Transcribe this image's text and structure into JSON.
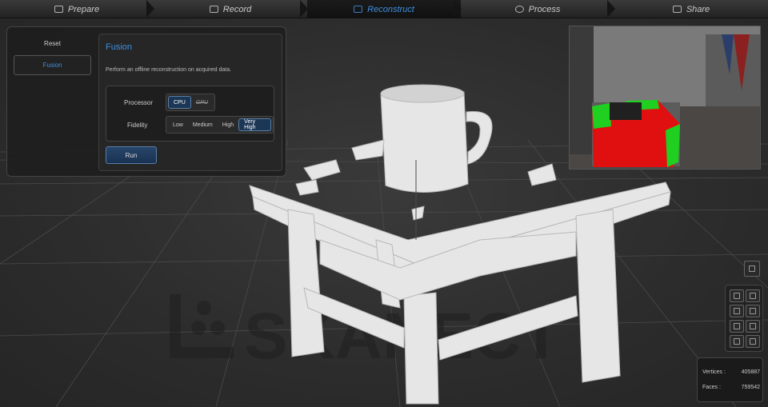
{
  "workflow": {
    "steps": [
      {
        "label": "Prepare",
        "icon": "prepare-icon",
        "active": false
      },
      {
        "label": "Record",
        "icon": "record-icon",
        "active": false
      },
      {
        "label": "Reconstruct",
        "icon": "reconstruct-icon",
        "active": true
      },
      {
        "label": "Process",
        "icon": "process-icon",
        "active": false
      },
      {
        "label": "Share",
        "icon": "share-icon",
        "active": false
      }
    ]
  },
  "sidebar": {
    "items": [
      {
        "label": "Reset"
      },
      {
        "label": "Fusion"
      }
    ]
  },
  "fusion": {
    "title": "Fusion",
    "description": "Perform an offline reconstruction on acquired data.",
    "processor_label": "Processor",
    "processor_options": [
      "CPU",
      "GPU"
    ],
    "processor_selected": "CPU",
    "fidelity_label": "Fidelity",
    "fidelity_options": [
      "Low",
      "Medium",
      "High",
      "Very High"
    ],
    "fidelity_selected": "Very High",
    "run_label": "Run"
  },
  "stats": {
    "vertices_label": "Vertices :",
    "vertices_value": "405887",
    "faces_label": "Faces :",
    "faces_value": "759542"
  },
  "watermark": "SKANECT",
  "colors": {
    "accent": "#3d8fe0",
    "depth_red": "#e01010",
    "depth_green": "#20d020",
    "mesh": "#e8e8e8"
  }
}
